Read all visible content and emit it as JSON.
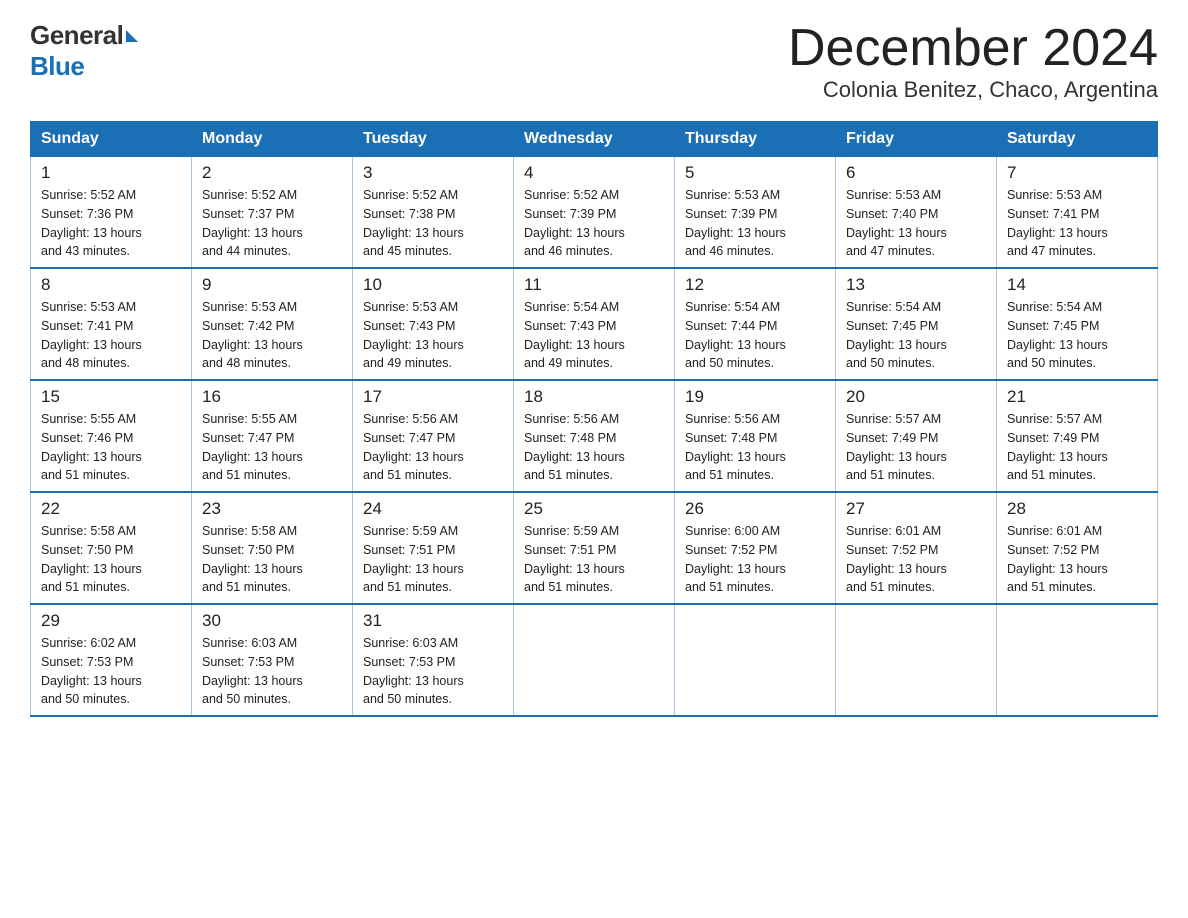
{
  "header": {
    "logo_general": "General",
    "logo_blue": "Blue",
    "title": "December 2024",
    "subtitle": "Colonia Benitez, Chaco, Argentina"
  },
  "days_of_week": [
    "Sunday",
    "Monday",
    "Tuesday",
    "Wednesday",
    "Thursday",
    "Friday",
    "Saturday"
  ],
  "weeks": [
    [
      {
        "day": "1",
        "sunrise": "5:52 AM",
        "sunset": "7:36 PM",
        "daylight": "13 hours and 43 minutes."
      },
      {
        "day": "2",
        "sunrise": "5:52 AM",
        "sunset": "7:37 PM",
        "daylight": "13 hours and 44 minutes."
      },
      {
        "day": "3",
        "sunrise": "5:52 AM",
        "sunset": "7:38 PM",
        "daylight": "13 hours and 45 minutes."
      },
      {
        "day": "4",
        "sunrise": "5:52 AM",
        "sunset": "7:39 PM",
        "daylight": "13 hours and 46 minutes."
      },
      {
        "day": "5",
        "sunrise": "5:53 AM",
        "sunset": "7:39 PM",
        "daylight": "13 hours and 46 minutes."
      },
      {
        "day": "6",
        "sunrise": "5:53 AM",
        "sunset": "7:40 PM",
        "daylight": "13 hours and 47 minutes."
      },
      {
        "day": "7",
        "sunrise": "5:53 AM",
        "sunset": "7:41 PM",
        "daylight": "13 hours and 47 minutes."
      }
    ],
    [
      {
        "day": "8",
        "sunrise": "5:53 AM",
        "sunset": "7:41 PM",
        "daylight": "13 hours and 48 minutes."
      },
      {
        "day": "9",
        "sunrise": "5:53 AM",
        "sunset": "7:42 PM",
        "daylight": "13 hours and 48 minutes."
      },
      {
        "day": "10",
        "sunrise": "5:53 AM",
        "sunset": "7:43 PM",
        "daylight": "13 hours and 49 minutes."
      },
      {
        "day": "11",
        "sunrise": "5:54 AM",
        "sunset": "7:43 PM",
        "daylight": "13 hours and 49 minutes."
      },
      {
        "day": "12",
        "sunrise": "5:54 AM",
        "sunset": "7:44 PM",
        "daylight": "13 hours and 50 minutes."
      },
      {
        "day": "13",
        "sunrise": "5:54 AM",
        "sunset": "7:45 PM",
        "daylight": "13 hours and 50 minutes."
      },
      {
        "day": "14",
        "sunrise": "5:54 AM",
        "sunset": "7:45 PM",
        "daylight": "13 hours and 50 minutes."
      }
    ],
    [
      {
        "day": "15",
        "sunrise": "5:55 AM",
        "sunset": "7:46 PM",
        "daylight": "13 hours and 51 minutes."
      },
      {
        "day": "16",
        "sunrise": "5:55 AM",
        "sunset": "7:47 PM",
        "daylight": "13 hours and 51 minutes."
      },
      {
        "day": "17",
        "sunrise": "5:56 AM",
        "sunset": "7:47 PM",
        "daylight": "13 hours and 51 minutes."
      },
      {
        "day": "18",
        "sunrise": "5:56 AM",
        "sunset": "7:48 PM",
        "daylight": "13 hours and 51 minutes."
      },
      {
        "day": "19",
        "sunrise": "5:56 AM",
        "sunset": "7:48 PM",
        "daylight": "13 hours and 51 minutes."
      },
      {
        "day": "20",
        "sunrise": "5:57 AM",
        "sunset": "7:49 PM",
        "daylight": "13 hours and 51 minutes."
      },
      {
        "day": "21",
        "sunrise": "5:57 AM",
        "sunset": "7:49 PM",
        "daylight": "13 hours and 51 minutes."
      }
    ],
    [
      {
        "day": "22",
        "sunrise": "5:58 AM",
        "sunset": "7:50 PM",
        "daylight": "13 hours and 51 minutes."
      },
      {
        "day": "23",
        "sunrise": "5:58 AM",
        "sunset": "7:50 PM",
        "daylight": "13 hours and 51 minutes."
      },
      {
        "day": "24",
        "sunrise": "5:59 AM",
        "sunset": "7:51 PM",
        "daylight": "13 hours and 51 minutes."
      },
      {
        "day": "25",
        "sunrise": "5:59 AM",
        "sunset": "7:51 PM",
        "daylight": "13 hours and 51 minutes."
      },
      {
        "day": "26",
        "sunrise": "6:00 AM",
        "sunset": "7:52 PM",
        "daylight": "13 hours and 51 minutes."
      },
      {
        "day": "27",
        "sunrise": "6:01 AM",
        "sunset": "7:52 PM",
        "daylight": "13 hours and 51 minutes."
      },
      {
        "day": "28",
        "sunrise": "6:01 AM",
        "sunset": "7:52 PM",
        "daylight": "13 hours and 51 minutes."
      }
    ],
    [
      {
        "day": "29",
        "sunrise": "6:02 AM",
        "sunset": "7:53 PM",
        "daylight": "13 hours and 50 minutes."
      },
      {
        "day": "30",
        "sunrise": "6:03 AM",
        "sunset": "7:53 PM",
        "daylight": "13 hours and 50 minutes."
      },
      {
        "day": "31",
        "sunrise": "6:03 AM",
        "sunset": "7:53 PM",
        "daylight": "13 hours and 50 minutes."
      },
      null,
      null,
      null,
      null
    ]
  ],
  "labels": {
    "sunrise": "Sunrise:",
    "sunset": "Sunset:",
    "daylight": "Daylight:"
  }
}
